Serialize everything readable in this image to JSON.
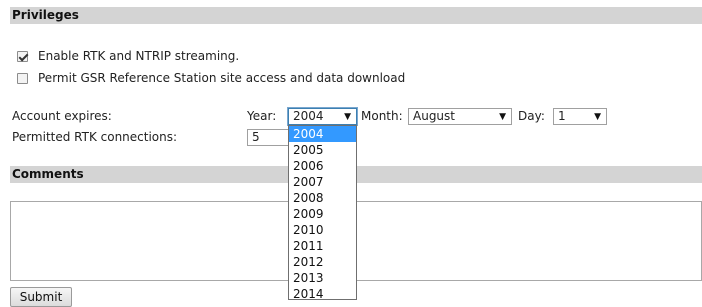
{
  "privileges": {
    "title": "Privileges",
    "checkboxes": [
      {
        "label": "Enable RTK and NTRIP streaming.",
        "checked": true
      },
      {
        "label": "Permit GSR Reference Station site access and data download",
        "checked": false
      }
    ]
  },
  "account": {
    "expires_label": "Account expires:",
    "year_label": "Year:",
    "year_value": "2004",
    "month_label": "Month:",
    "month_value": "August",
    "day_label": "Day:",
    "day_value": "1",
    "rtk_label": "Permitted RTK connections:",
    "rtk_value": "5"
  },
  "year_dropdown": {
    "options": [
      "2004",
      "2005",
      "2006",
      "2007",
      "2008",
      "2009",
      "2010",
      "2011",
      "2012",
      "2013",
      "2014"
    ],
    "selected": "2004"
  },
  "comments": {
    "title": "Comments",
    "value": ""
  },
  "submit_label": "Submit",
  "icons": {
    "dropdown_arrow": "chevron-down-icon",
    "checkbox": "checkbox-icon"
  },
  "colors": {
    "section_bar": "#d4d4d4",
    "selected_option": "#3399ff"
  }
}
